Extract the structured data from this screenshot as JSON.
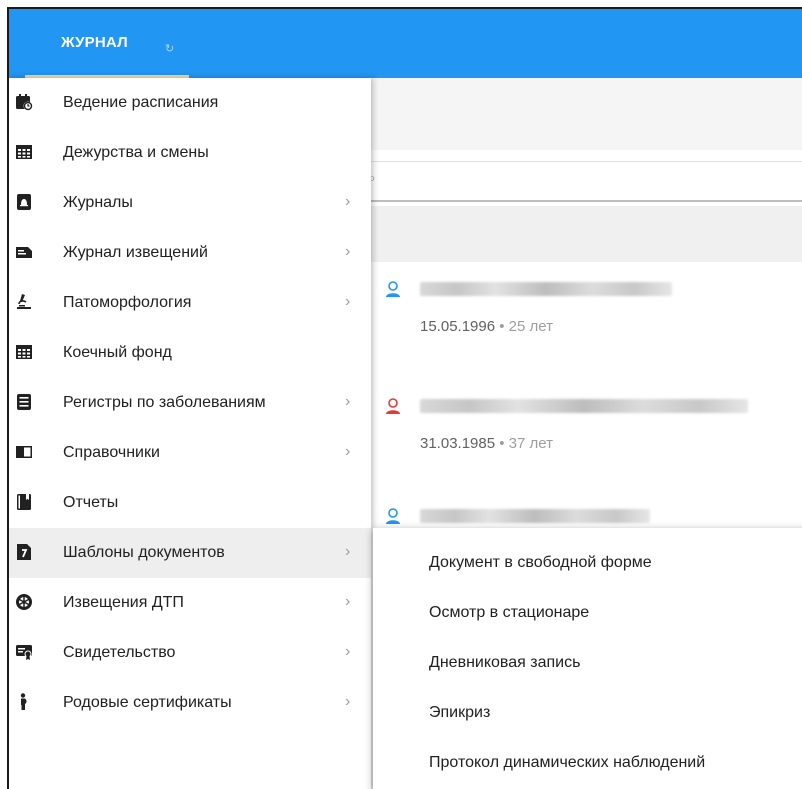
{
  "tab": {
    "label": "ЖУРНАЛ",
    "refresh_icon": "refresh-icon"
  },
  "menu": {
    "items": [
      {
        "label": "Ведение расписания",
        "icon": "calendar-clock-icon",
        "chevron": false
      },
      {
        "label": "Дежурства и смены",
        "icon": "table-icon",
        "chevron": false
      },
      {
        "label": "Журналы",
        "icon": "bell-icon",
        "chevron": true
      },
      {
        "label": "Журнал извещений",
        "icon": "notice-icon",
        "chevron": true
      },
      {
        "label": "Патоморфология",
        "icon": "microscope-icon",
        "chevron": true
      },
      {
        "label": "Коечный фонд",
        "icon": "table-icon",
        "chevron": false
      },
      {
        "label": "Регистры по заболеваниям",
        "icon": "registry-icon",
        "chevron": true
      },
      {
        "label": "Справочники",
        "icon": "book-open-icon",
        "chevron": true
      },
      {
        "label": "Отчеты",
        "icon": "book-icon",
        "chevron": false
      },
      {
        "label": "Шаблоны документов",
        "icon": "document-template-icon",
        "chevron": true,
        "active": true
      },
      {
        "label": "Извещения ДТП",
        "icon": "wheel-icon",
        "chevron": true
      },
      {
        "label": "Свидетельство",
        "icon": "certificate-icon",
        "chevron": true
      },
      {
        "label": "Родовые сертификаты",
        "icon": "pregnant-icon",
        "chevron": true
      }
    ],
    "chevron_glyph": "›"
  },
  "submenu": {
    "items": [
      {
        "label": "Документ в свободной форме"
      },
      {
        "label": "Осмотр в стационаре"
      },
      {
        "label": "Дневниковая запись"
      },
      {
        "label": "Эпикриз"
      },
      {
        "label": "Протокол динамических наблюдений"
      }
    ]
  },
  "patients": [
    {
      "dob": "15.05.1996",
      "age": "• 25 лет",
      "gender": "male",
      "color": "#2196f3"
    },
    {
      "dob": "31.03.1985",
      "age": "• 37 лет",
      "gender": "female",
      "color": "#e53935"
    },
    {
      "dob": "",
      "age": "",
      "gender": "male",
      "color": "#2196f3"
    }
  ],
  "colors": {
    "appbar": "#2196f3",
    "tab_indicator": "#f5d7a8",
    "active_item": "#eeeeee"
  }
}
